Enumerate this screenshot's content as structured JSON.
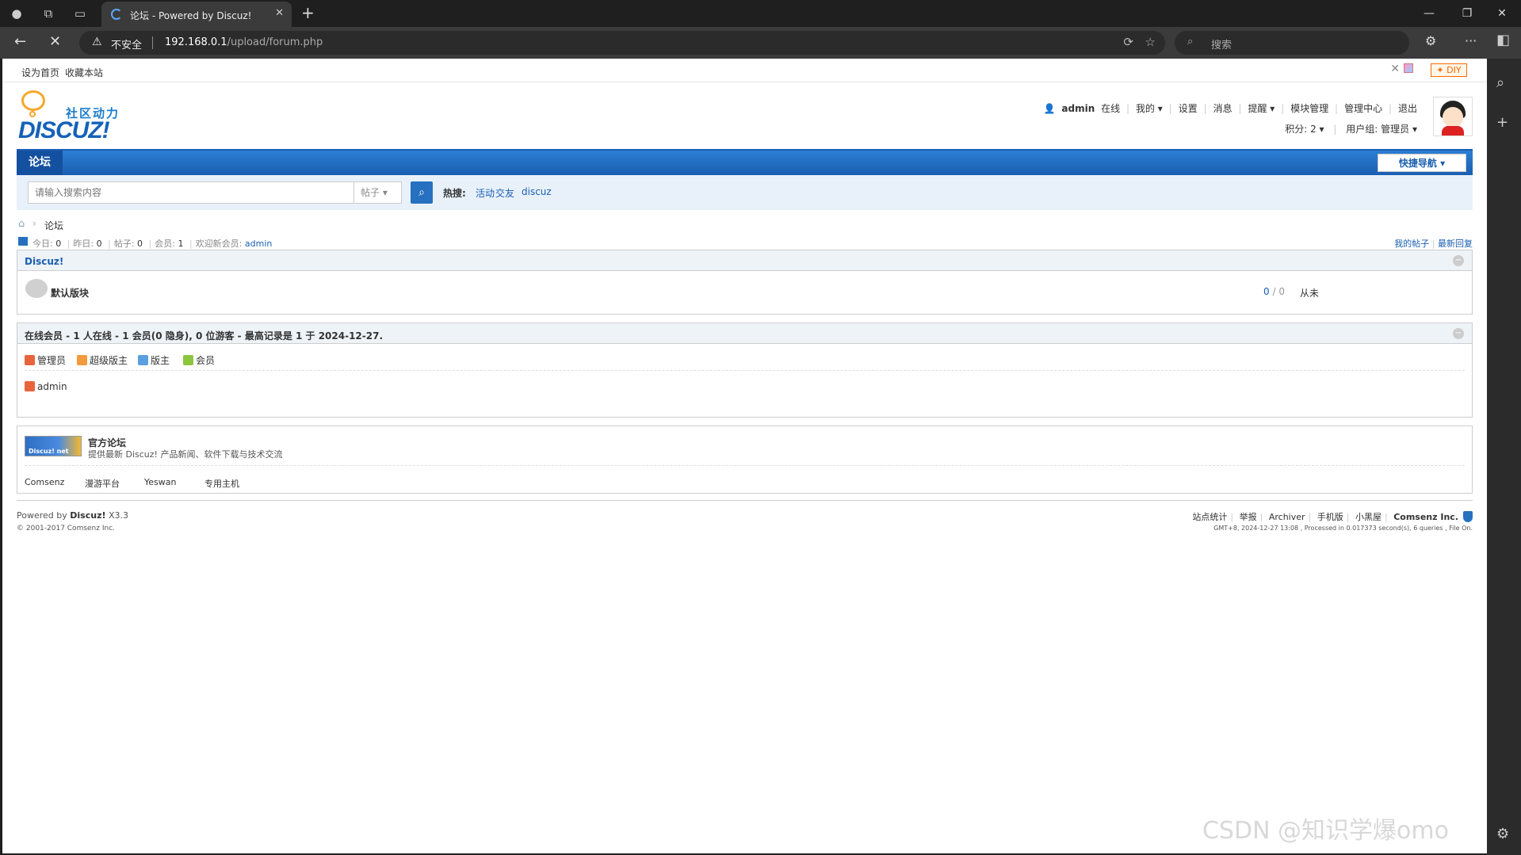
{
  "browser": {
    "tab_title": "论坛 - Powered by Discuz!",
    "security_label": "不安全",
    "url_host": "192.168.0.1",
    "url_path": "/upload/forum.php",
    "search_placeholder": "搜索"
  },
  "topbar": {
    "set_home": "设为首页",
    "bookmark": "收藏本站",
    "diy": "✦ DIY"
  },
  "logo": {
    "tagline": "社区动力",
    "brand": "DISCUZ!"
  },
  "user": {
    "name": "admin",
    "status": "在线",
    "menu": [
      "我的 ▾",
      "设置",
      "消息",
      "提醒 ▾",
      "模块管理",
      "管理中心",
      "退出"
    ],
    "credits": "积分: 2 ▾",
    "group": "用户组: 管理员 ▾"
  },
  "nav": {
    "forum": "论坛",
    "quick_nav": "快捷导航 ▾"
  },
  "search": {
    "placeholder": "请输入搜索内容",
    "type": "帖子",
    "hot_label": "热搜:",
    "hot": [
      "活动",
      "交友",
      "discuz"
    ]
  },
  "breadcrumb": {
    "current": "论坛"
  },
  "stats": {
    "today": "今日: ",
    "today_val": "0",
    "yesterday": "昨日: ",
    "yesterday_val": "0",
    "posts": "帖子: ",
    "posts_val": "0",
    "members": "会员: ",
    "members_val": "1",
    "welcome": "欢迎新会员: ",
    "welcome_user": "admin",
    "my_posts": "我的帖子",
    "latest_reply": "最新回复"
  },
  "category": {
    "title": "Discuz!",
    "forum_name": "默认版块",
    "count_a": "0",
    "count_sep": " / ",
    "count_b": "0",
    "last_post": "从未"
  },
  "online": {
    "title": "在线会员 - 1 人在线 - 1 会员(0 隐身), 0 位游客 - 最高记录是 1 于 2024-12-27.",
    "legend": [
      {
        "label": "管理员",
        "color": "#e8643c"
      },
      {
        "label": "超级版主",
        "color": "#f29a3c"
      },
      {
        "label": "版主",
        "color": "#5aa0e0"
      },
      {
        "label": "会员",
        "color": "#8cc63f"
      }
    ],
    "users": [
      "admin"
    ]
  },
  "links": {
    "logo_text": "Discuz! net",
    "title": "官方论坛",
    "desc": "提供最新 Discuz! 产品新闻、软件下载与技术交流",
    "items": [
      "Comsenz",
      "漫游平台",
      "Yeswan",
      "专用主机"
    ]
  },
  "footer": {
    "powered": "Powered by ",
    "brand": "Discuz!",
    "version": " X3.3",
    "copyright": "© 2001-2017 Comsenz Inc.",
    "links": [
      "站点统计",
      "举报",
      "Archiver",
      "手机版",
      "小黑屋"
    ],
    "company": "Comsenz Inc.",
    "info": "GMT+8, 2024-12-27 13:08 , Processed in 0.017373 second(s), 6 queries , File On."
  },
  "watermark": "CSDN @知识学爆omo"
}
